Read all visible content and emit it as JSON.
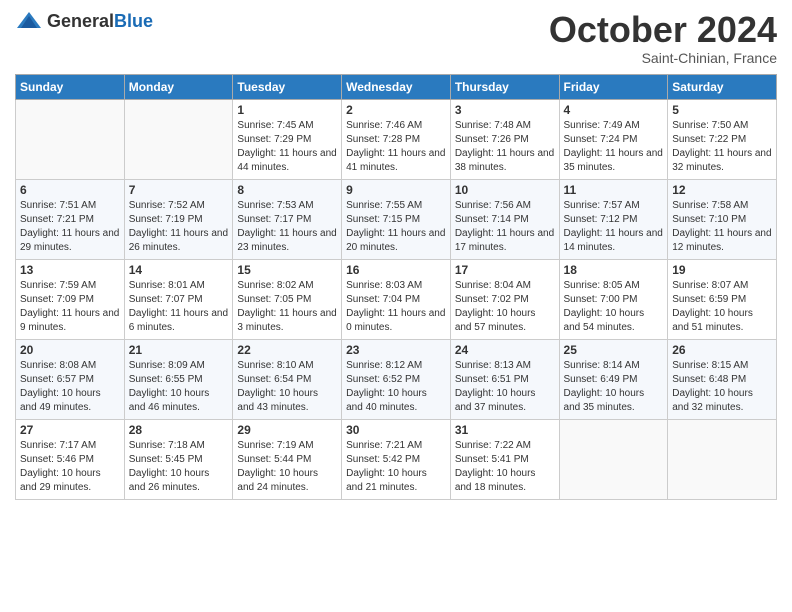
{
  "header": {
    "logo_general": "General",
    "logo_blue": "Blue",
    "month_title": "October 2024",
    "subtitle": "Saint-Chinian, France"
  },
  "days_of_week": [
    "Sunday",
    "Monday",
    "Tuesday",
    "Wednesday",
    "Thursday",
    "Friday",
    "Saturday"
  ],
  "weeks": [
    [
      {
        "day": "",
        "sunrise": "",
        "sunset": "",
        "daylight": ""
      },
      {
        "day": "",
        "sunrise": "",
        "sunset": "",
        "daylight": ""
      },
      {
        "day": "1",
        "sunrise": "Sunrise: 7:45 AM",
        "sunset": "Sunset: 7:29 PM",
        "daylight": "Daylight: 11 hours and 44 minutes."
      },
      {
        "day": "2",
        "sunrise": "Sunrise: 7:46 AM",
        "sunset": "Sunset: 7:28 PM",
        "daylight": "Daylight: 11 hours and 41 minutes."
      },
      {
        "day": "3",
        "sunrise": "Sunrise: 7:48 AM",
        "sunset": "Sunset: 7:26 PM",
        "daylight": "Daylight: 11 hours and 38 minutes."
      },
      {
        "day": "4",
        "sunrise": "Sunrise: 7:49 AM",
        "sunset": "Sunset: 7:24 PM",
        "daylight": "Daylight: 11 hours and 35 minutes."
      },
      {
        "day": "5",
        "sunrise": "Sunrise: 7:50 AM",
        "sunset": "Sunset: 7:22 PM",
        "daylight": "Daylight: 11 hours and 32 minutes."
      }
    ],
    [
      {
        "day": "6",
        "sunrise": "Sunrise: 7:51 AM",
        "sunset": "Sunset: 7:21 PM",
        "daylight": "Daylight: 11 hours and 29 minutes."
      },
      {
        "day": "7",
        "sunrise": "Sunrise: 7:52 AM",
        "sunset": "Sunset: 7:19 PM",
        "daylight": "Daylight: 11 hours and 26 minutes."
      },
      {
        "day": "8",
        "sunrise": "Sunrise: 7:53 AM",
        "sunset": "Sunset: 7:17 PM",
        "daylight": "Daylight: 11 hours and 23 minutes."
      },
      {
        "day": "9",
        "sunrise": "Sunrise: 7:55 AM",
        "sunset": "Sunset: 7:15 PM",
        "daylight": "Daylight: 11 hours and 20 minutes."
      },
      {
        "day": "10",
        "sunrise": "Sunrise: 7:56 AM",
        "sunset": "Sunset: 7:14 PM",
        "daylight": "Daylight: 11 hours and 17 minutes."
      },
      {
        "day": "11",
        "sunrise": "Sunrise: 7:57 AM",
        "sunset": "Sunset: 7:12 PM",
        "daylight": "Daylight: 11 hours and 14 minutes."
      },
      {
        "day": "12",
        "sunrise": "Sunrise: 7:58 AM",
        "sunset": "Sunset: 7:10 PM",
        "daylight": "Daylight: 11 hours and 12 minutes."
      }
    ],
    [
      {
        "day": "13",
        "sunrise": "Sunrise: 7:59 AM",
        "sunset": "Sunset: 7:09 PM",
        "daylight": "Daylight: 11 hours and 9 minutes."
      },
      {
        "day": "14",
        "sunrise": "Sunrise: 8:01 AM",
        "sunset": "Sunset: 7:07 PM",
        "daylight": "Daylight: 11 hours and 6 minutes."
      },
      {
        "day": "15",
        "sunrise": "Sunrise: 8:02 AM",
        "sunset": "Sunset: 7:05 PM",
        "daylight": "Daylight: 11 hours and 3 minutes."
      },
      {
        "day": "16",
        "sunrise": "Sunrise: 8:03 AM",
        "sunset": "Sunset: 7:04 PM",
        "daylight": "Daylight: 11 hours and 0 minutes."
      },
      {
        "day": "17",
        "sunrise": "Sunrise: 8:04 AM",
        "sunset": "Sunset: 7:02 PM",
        "daylight": "Daylight: 10 hours and 57 minutes."
      },
      {
        "day": "18",
        "sunrise": "Sunrise: 8:05 AM",
        "sunset": "Sunset: 7:00 PM",
        "daylight": "Daylight: 10 hours and 54 minutes."
      },
      {
        "day": "19",
        "sunrise": "Sunrise: 8:07 AM",
        "sunset": "Sunset: 6:59 PM",
        "daylight": "Daylight: 10 hours and 51 minutes."
      }
    ],
    [
      {
        "day": "20",
        "sunrise": "Sunrise: 8:08 AM",
        "sunset": "Sunset: 6:57 PM",
        "daylight": "Daylight: 10 hours and 49 minutes."
      },
      {
        "day": "21",
        "sunrise": "Sunrise: 8:09 AM",
        "sunset": "Sunset: 6:55 PM",
        "daylight": "Daylight: 10 hours and 46 minutes."
      },
      {
        "day": "22",
        "sunrise": "Sunrise: 8:10 AM",
        "sunset": "Sunset: 6:54 PM",
        "daylight": "Daylight: 10 hours and 43 minutes."
      },
      {
        "day": "23",
        "sunrise": "Sunrise: 8:12 AM",
        "sunset": "Sunset: 6:52 PM",
        "daylight": "Daylight: 10 hours and 40 minutes."
      },
      {
        "day": "24",
        "sunrise": "Sunrise: 8:13 AM",
        "sunset": "Sunset: 6:51 PM",
        "daylight": "Daylight: 10 hours and 37 minutes."
      },
      {
        "day": "25",
        "sunrise": "Sunrise: 8:14 AM",
        "sunset": "Sunset: 6:49 PM",
        "daylight": "Daylight: 10 hours and 35 minutes."
      },
      {
        "day": "26",
        "sunrise": "Sunrise: 8:15 AM",
        "sunset": "Sunset: 6:48 PM",
        "daylight": "Daylight: 10 hours and 32 minutes."
      }
    ],
    [
      {
        "day": "27",
        "sunrise": "Sunrise: 7:17 AM",
        "sunset": "Sunset: 5:46 PM",
        "daylight": "Daylight: 10 hours and 29 minutes."
      },
      {
        "day": "28",
        "sunrise": "Sunrise: 7:18 AM",
        "sunset": "Sunset: 5:45 PM",
        "daylight": "Daylight: 10 hours and 26 minutes."
      },
      {
        "day": "29",
        "sunrise": "Sunrise: 7:19 AM",
        "sunset": "Sunset: 5:44 PM",
        "daylight": "Daylight: 10 hours and 24 minutes."
      },
      {
        "day": "30",
        "sunrise": "Sunrise: 7:21 AM",
        "sunset": "Sunset: 5:42 PM",
        "daylight": "Daylight: 10 hours and 21 minutes."
      },
      {
        "day": "31",
        "sunrise": "Sunrise: 7:22 AM",
        "sunset": "Sunset: 5:41 PM",
        "daylight": "Daylight: 10 hours and 18 minutes."
      },
      {
        "day": "",
        "sunrise": "",
        "sunset": "",
        "daylight": ""
      },
      {
        "day": "",
        "sunrise": "",
        "sunset": "",
        "daylight": ""
      }
    ]
  ]
}
